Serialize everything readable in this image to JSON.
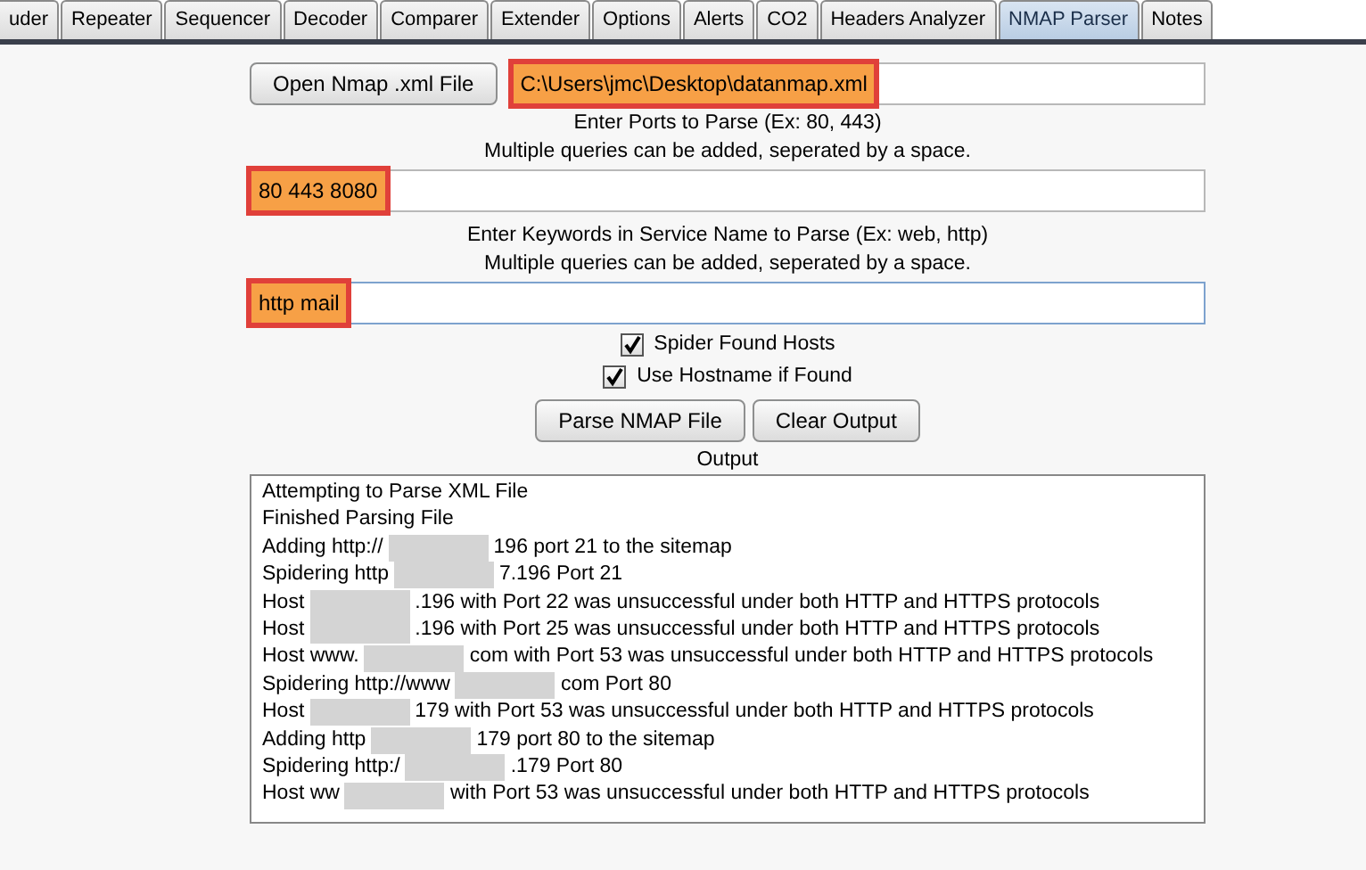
{
  "tabs": [
    {
      "label": "uder",
      "selected": false
    },
    {
      "label": "Repeater",
      "selected": false
    },
    {
      "label": "Sequencer",
      "selected": false
    },
    {
      "label": "Decoder",
      "selected": false
    },
    {
      "label": "Comparer",
      "selected": false
    },
    {
      "label": "Extender",
      "selected": false
    },
    {
      "label": "Options",
      "selected": false
    },
    {
      "label": "Alerts",
      "selected": false
    },
    {
      "label": "CO2",
      "selected": false
    },
    {
      "label": "Headers Analyzer",
      "selected": false
    },
    {
      "label": "NMAP Parser",
      "selected": true
    },
    {
      "label": "Notes",
      "selected": false
    }
  ],
  "open_button": "Open Nmap .xml File",
  "file_field": {
    "value": "C:\\Users\\jmc\\Desktop\\datanmap.xml",
    "highlighted": true,
    "focused": false
  },
  "ports_hint": "Enter Ports to Parse (Ex: 80, 443)",
  "ports_note": "Multiple queries can be added, seperated by a space.",
  "ports_field": {
    "value": "80 443 8080",
    "highlighted": true,
    "focused": false
  },
  "keywords_hint": "Enter Keywords in Service Name to Parse (Ex: web, http)",
  "keywords_note": "Multiple queries can be added, seperated by a space.",
  "keywords_field": {
    "value": "http mail",
    "highlighted": true,
    "focused": true
  },
  "checkboxes": [
    {
      "label": "Spider Found Hosts",
      "checked": true
    },
    {
      "label": "Use Hostname if Found",
      "checked": true
    }
  ],
  "buttons": [
    "Parse NMAP File",
    "Clear Output"
  ],
  "output_label": "Output",
  "output_lines": [
    [
      {
        "kind": "text",
        "text": "Attempting to Parse XML File"
      }
    ],
    [
      {
        "kind": "text",
        "text": "Finished Parsing File"
      }
    ],
    [
      {
        "kind": "text",
        "text": "Adding http://"
      },
      {
        "kind": "redacted"
      },
      {
        "kind": "text",
        "text": "196 port 21 to the sitemap"
      }
    ],
    [
      {
        "kind": "text",
        "text": "Spidering http"
      },
      {
        "kind": "redacted"
      },
      {
        "kind": "text",
        "text": "7.196 Port 21"
      }
    ],
    [
      {
        "kind": "text",
        "text": "Host"
      },
      {
        "kind": "redacted"
      },
      {
        "kind": "text",
        "text": ".196 with Port 22 was unsuccessful under both HTTP and HTTPS protocols"
      }
    ],
    [
      {
        "kind": "text",
        "text": "Host"
      },
      {
        "kind": "redacted"
      },
      {
        "kind": "text",
        "text": ".196 with Port 25 was unsuccessful under both HTTP and HTTPS protocols"
      }
    ],
    [
      {
        "kind": "text",
        "text": "Host www."
      },
      {
        "kind": "redacted"
      },
      {
        "kind": "text",
        "text": "com with Port 53 was unsuccessful under both HTTP and HTTPS protocols"
      }
    ],
    [
      {
        "kind": "text",
        "text": "Spidering http://www"
      },
      {
        "kind": "redacted"
      },
      {
        "kind": "text",
        "text": "com Port 80"
      }
    ],
    [
      {
        "kind": "text",
        "text": "Host"
      },
      {
        "kind": "redacted"
      },
      {
        "kind": "text",
        "text": "179 with Port 53 was unsuccessful under both HTTP and HTTPS protocols"
      }
    ],
    [
      {
        "kind": "text",
        "text": "Adding http"
      },
      {
        "kind": "redacted"
      },
      {
        "kind": "text",
        "text": "179 port 80 to the sitemap"
      }
    ],
    [
      {
        "kind": "text",
        "text": "Spidering http:/"
      },
      {
        "kind": "redacted"
      },
      {
        "kind": "text",
        "text": ".179 Port 80"
      }
    ],
    [
      {
        "kind": "text",
        "text": "Host ww"
      },
      {
        "kind": "redacted"
      },
      {
        "kind": "text",
        "text": "with Port 53 was unsuccessful under both HTTP and HTTPS protocols"
      }
    ]
  ]
}
